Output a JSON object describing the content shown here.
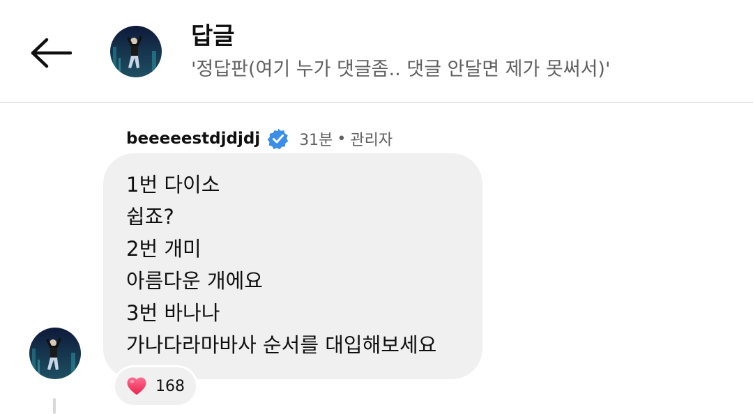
{
  "header": {
    "title": "답글",
    "subtitle": "'정답판(여기 누가 댓글좀.. 댓글 안달면 제가 못써서)'",
    "back_icon": "arrow-left-icon"
  },
  "comment": {
    "author": "beeeeestdjdjdj",
    "time": "31분",
    "separator": "•",
    "role": "관리자",
    "verified_icon": "verified-check-icon",
    "verified_color": "#3a8ee6",
    "lines": [
      "1번 다이소",
      "쉽죠?",
      "2번 개미",
      "아름다운 개에요",
      "3번 바나나",
      "가나다라마바사 순서를 대입해보세요"
    ],
    "reaction": {
      "icon": "heart-icon",
      "color": "#f23d6b",
      "count": "168"
    }
  },
  "colors": {
    "bubble": "#f0f0f0",
    "muted_text": "#606060",
    "divider": "#e5e5e5"
  }
}
